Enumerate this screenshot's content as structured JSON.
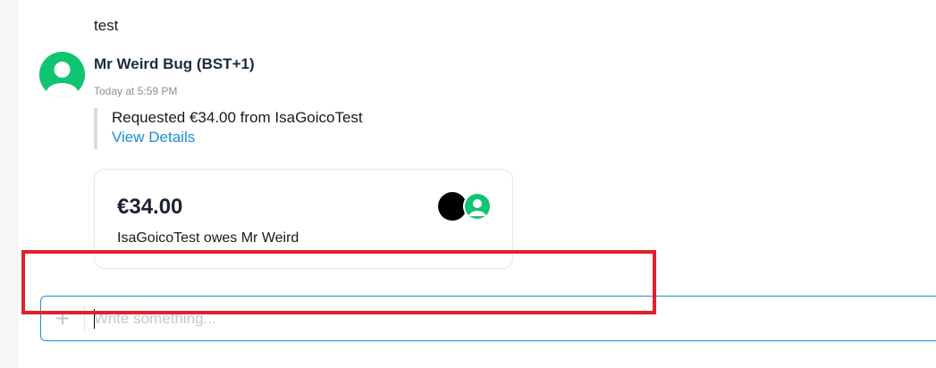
{
  "thread": {
    "previous_message": "test"
  },
  "message": {
    "author": "Mr Weird Bug (BST+1)",
    "timestamp": "Today at 5:59 PM",
    "request_text": "Requested €34.00 from IsaGoicoTest",
    "view_details_label": "View Details"
  },
  "payment_card": {
    "amount": "€34.00",
    "description": "IsaGoicoTest owes Mr Weird"
  },
  "composer": {
    "placeholder": "Write something...",
    "value": ""
  },
  "colors": {
    "avatar_green": "#11c471",
    "link_blue": "#1a8ed8",
    "highlight_red": "#e2202b"
  },
  "icons": {
    "avatar": "user-avatar-icon",
    "add": "plus-icon"
  }
}
